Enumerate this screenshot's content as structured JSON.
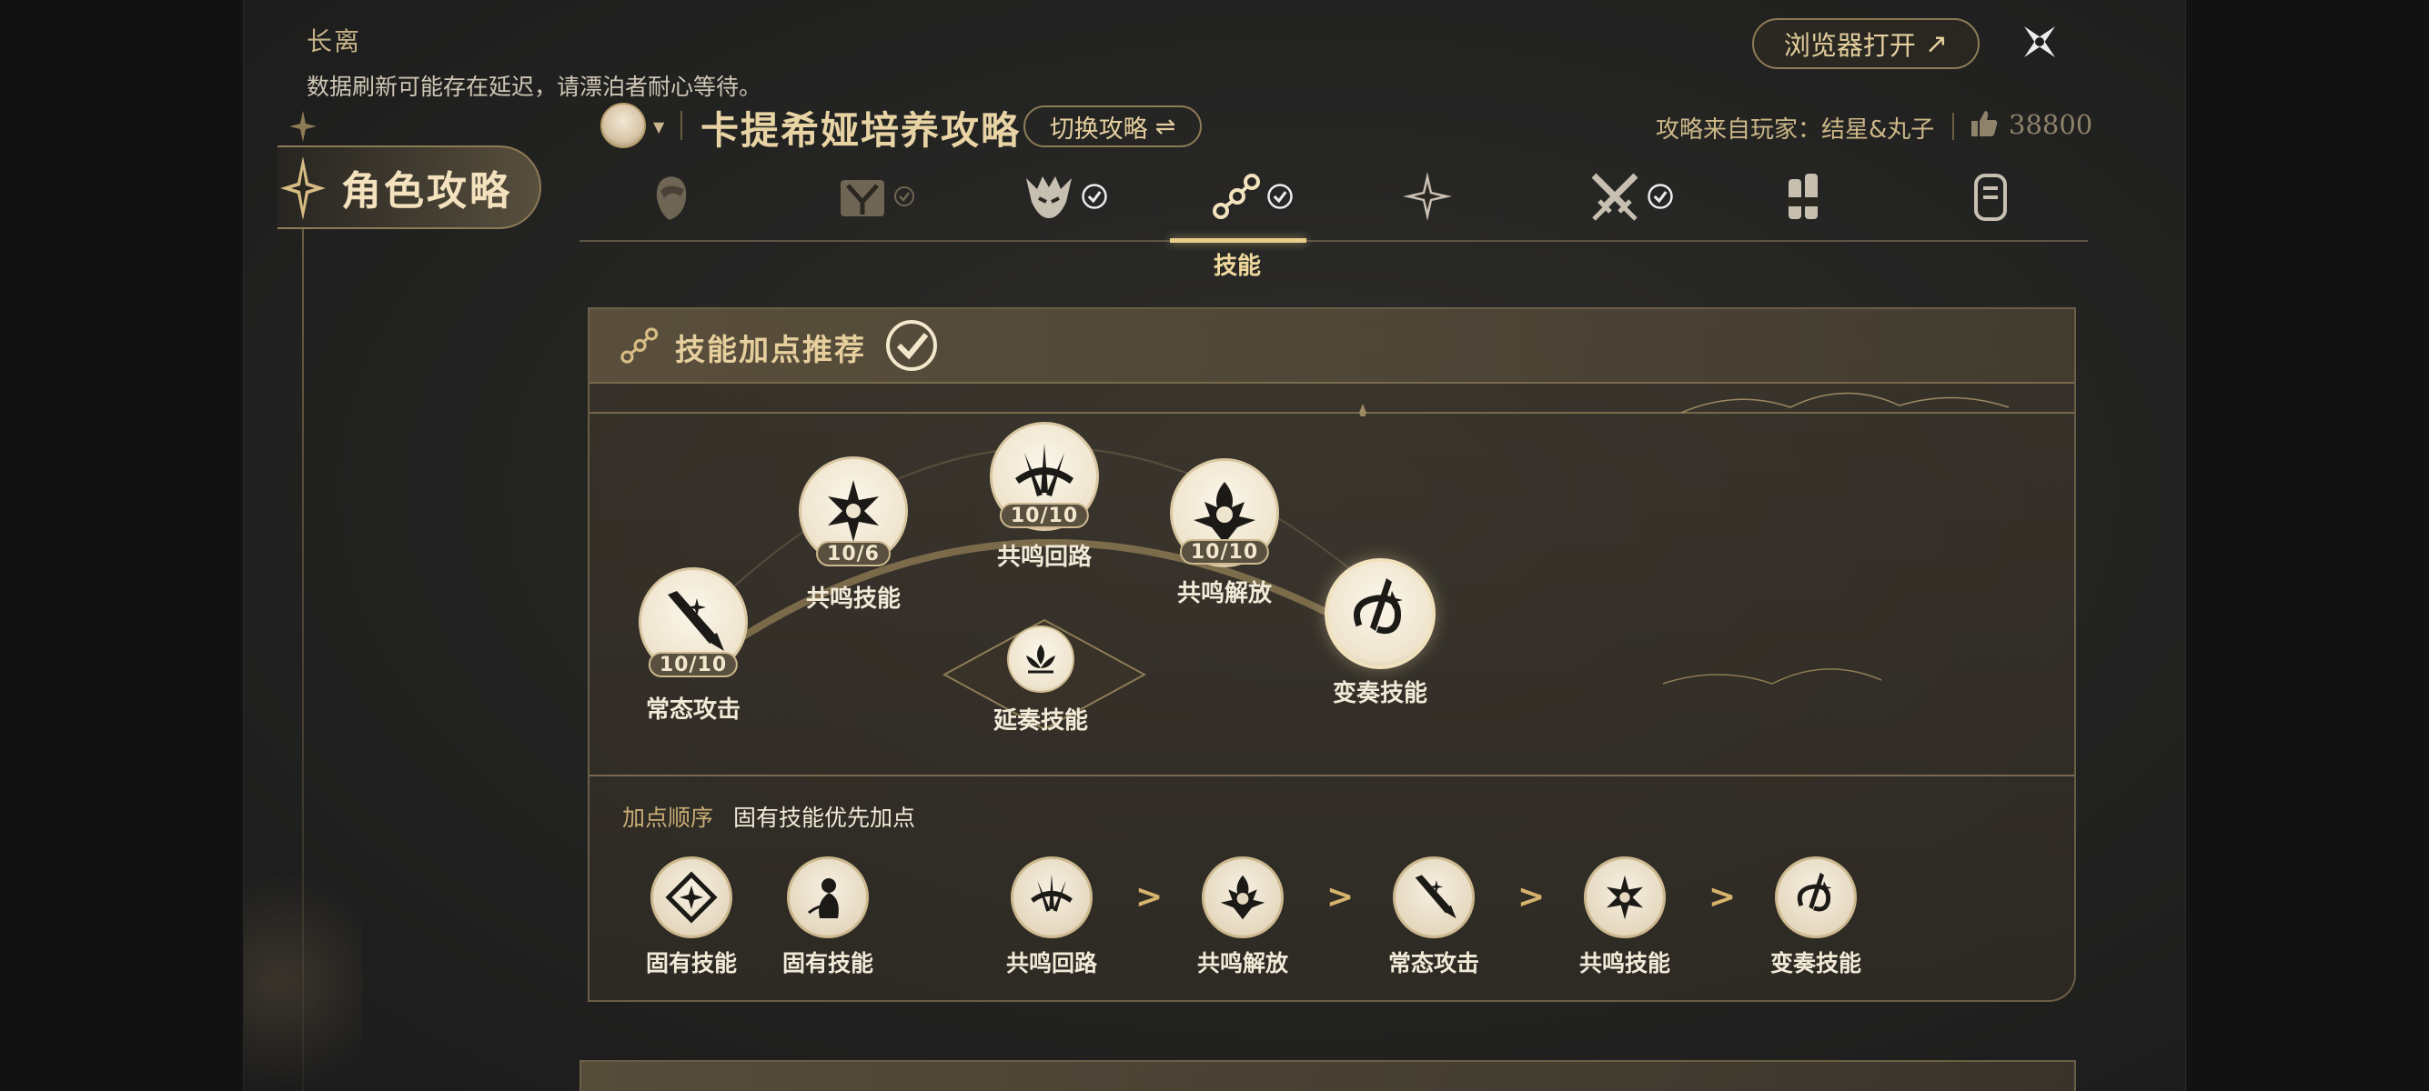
{
  "app": {
    "title": "长离",
    "notice": "数据刷新可能存在延迟，请漂泊者耐心等待。"
  },
  "toolbar": {
    "browser_label": "浏览器打开",
    "browser_arrow": "↗"
  },
  "nav": {
    "active_label": "角色攻略"
  },
  "guide": {
    "title": "卡提希娅培养攻略",
    "switch_label": "切换攻略",
    "switch_icon": "⇌",
    "source": "攻略来自玩家：结星&丸子",
    "likes": "38800"
  },
  "tabs": {
    "items": [
      {
        "icon": "character-portrait-icon",
        "checked": false
      },
      {
        "icon": "weapon-gear-icon",
        "checked": true,
        "faded": true
      },
      {
        "icon": "echo-mask-icon",
        "checked": true
      },
      {
        "icon": "skill-nodes-icon",
        "checked": true,
        "active": true,
        "label": "技能"
      },
      {
        "icon": "resonance-star-icon",
        "checked": false
      },
      {
        "icon": "crossed-swords-icon",
        "checked": true
      },
      {
        "icon": "team-figures-icon",
        "checked": false
      },
      {
        "icon": "materials-scroll-icon",
        "checked": false
      }
    ],
    "active_label": "技能"
  },
  "skills_panel": {
    "title": "技能加点推荐",
    "tree": [
      {
        "id": "basic",
        "name": "常态攻击",
        "level": "10/10",
        "icon": "sword-icon"
      },
      {
        "id": "skill",
        "name": "共鸣技能",
        "level": "10/6",
        "icon": "cross-emblem-icon"
      },
      {
        "id": "circuit",
        "name": "共鸣回路",
        "level": "10/10",
        "icon": "blade-fan-icon"
      },
      {
        "id": "liberation",
        "name": "共鸣解放",
        "level": "10/10",
        "icon": "figure-burst-icon"
      },
      {
        "id": "outro",
        "name": "变奏技能",
        "level": "",
        "icon": "spiral-blade-icon"
      },
      {
        "id": "intro",
        "name": "延奏技能",
        "level": "",
        "icon": "lotus-icon"
      }
    ],
    "order": {
      "heading": "加点顺序",
      "description": "固有技能优先加点",
      "items": [
        {
          "name": "固有技能",
          "icon": "diamond-icon"
        },
        {
          "name": "固有技能",
          "icon": "maiden-icon"
        },
        {
          "name": "共鸣回路",
          "icon": "blade-fan-icon"
        },
        {
          "name": "共鸣解放",
          "icon": "figure-burst-icon"
        },
        {
          "name": "常态攻击",
          "icon": "sword-icon"
        },
        {
          "name": "共鸣技能",
          "icon": "cross-emblem-icon"
        },
        {
          "name": "变奏技能",
          "icon": "spiral-blade-icon"
        }
      ],
      "arrow": ">"
    }
  },
  "colors": {
    "gold": "#e8d3a4",
    "accent": "#e9cd8a",
    "panel": "#3e372c",
    "bg": "#121212"
  }
}
